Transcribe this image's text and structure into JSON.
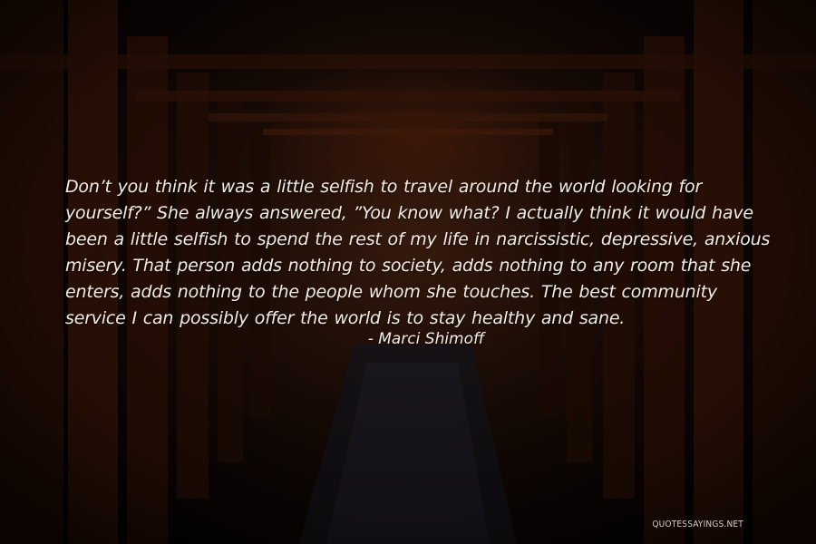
{
  "quote": {
    "text": "Don’t you think it was a little selfish to travel around the world looking for yourself?” She always answered, ”You know what? I actually think it would have been a little selfish to spend the rest of my life in narcissistic, depressive, anxious misery. That person adds nothing to society, adds nothing to any room that she enters, adds nothing to the people whom she touches. The best community service I can possibly offer the world is to stay healthy and sane.",
    "author": "- Marci Shimoff"
  },
  "watermark": "QUOTESSAYINGS.NET",
  "colors": {
    "text": "#f2ece6",
    "background_dark": "#140906",
    "torii_red": "#5a1e0c"
  }
}
